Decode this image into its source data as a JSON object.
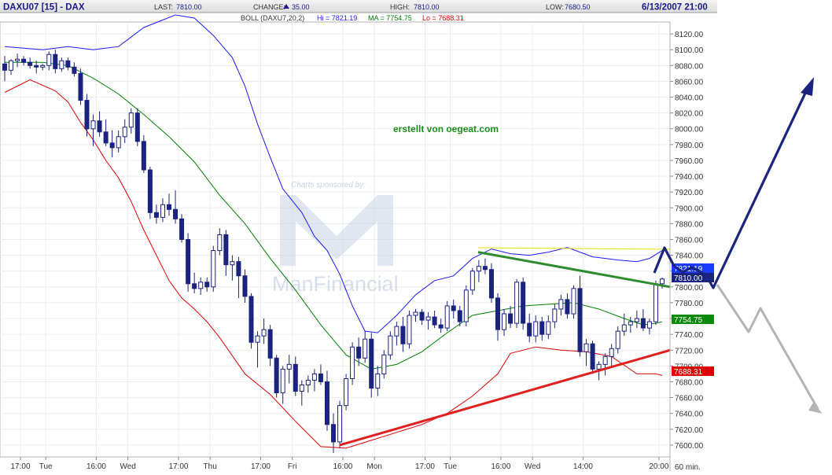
{
  "header": {
    "symbol": "DAXU07 [15] - DAX",
    "last_label": "LAST:",
    "last_value": "7810.00",
    "change_label": "CHANGE:",
    "change_value": "35.00",
    "high_label": "HIGH:",
    "high_value": "7810.00",
    "low_label": "LOW:",
    "low_value": "7680.50",
    "datetime": "6/13/2007 21:00"
  },
  "indicator": {
    "name": "BOLL (DAXU7,20,2)",
    "hi_text": "Hi = 7821.19",
    "ma_text": "MA = 7754.75",
    "lo_text": "Lo = 7688.31"
  },
  "annotation": "erstellt von oegeat.com",
  "watermark": {
    "sponsored": "Charts sponsored by:",
    "brand": "ManFinancial"
  },
  "badges": {
    "hi": "7821.19",
    "last": "7810.00",
    "ma": "7754.75",
    "lo": "7688.31"
  },
  "period": "60 min.",
  "colors": {
    "up_candle": "#ffffff",
    "down_candle": "#1a237e",
    "upper_band": "#1a1aff",
    "middle_band": "#008000",
    "lower_band": "#e00000",
    "resistance_line": "#2e8b2e",
    "support_line": "#e02020",
    "arrow_up": "#1a237e",
    "arrow_down": "#b0b0b0",
    "yellow_line": "#e8e000"
  },
  "chart_data": {
    "type": "candlestick",
    "y_ticks": [
      "7600.00",
      "7620.00",
      "7640.00",
      "7660.00",
      "7680.00",
      "7700.00",
      "7720.00",
      "7740.00",
      "7760.00",
      "7780.00",
      "7800.00",
      "7820.00",
      "7840.00",
      "7860.00",
      "7880.00",
      "7900.00",
      "7920.00",
      "7940.00",
      "7960.00",
      "7980.00",
      "8000.00",
      "8020.00",
      "8040.00",
      "8060.00",
      "8080.00",
      "8100.00",
      "8120.00"
    ],
    "x_labels": [
      "17:00",
      "Tue",
      "16:00",
      "Wed",
      "17:00",
      "Thu",
      "17:00",
      "Fri",
      "16:00",
      "Mon",
      "17:00",
      "Tue",
      "16:00",
      "Wed",
      "14:00",
      "20:00"
    ],
    "ylim": [
      7585,
      8135
    ],
    "candles": [
      [
        8082,
        8092,
        8060,
        8074
      ],
      [
        8074,
        8088,
        8068,
        8086
      ],
      [
        8086,
        8095,
        8078,
        8088
      ],
      [
        8088,
        8092,
        8080,
        8084
      ],
      [
        8084,
        8090,
        8076,
        8080
      ],
      [
        8080,
        8086,
        8070,
        8078
      ],
      [
        8078,
        8082,
        8074,
        8080
      ],
      [
        8080,
        8098,
        8074,
        8094
      ],
      [
        8094,
        8100,
        8070,
        8076
      ],
      [
        8076,
        8090,
        8072,
        8086
      ],
      [
        8086,
        8090,
        8074,
        8078
      ],
      [
        8078,
        8084,
        8066,
        8070
      ],
      [
        8070,
        8076,
        8030,
        8036
      ],
      [
        8036,
        8044,
        7990,
        8000
      ],
      [
        8000,
        8018,
        7978,
        8010
      ],
      [
        8010,
        8022,
        7990,
        7996
      ],
      [
        7996,
        8012,
        7978,
        7982
      ],
      [
        7982,
        7998,
        7964,
        7976
      ],
      [
        7976,
        7998,
        7970,
        7990
      ],
      [
        7990,
        8012,
        7982,
        8002
      ],
      [
        8002,
        8026,
        7994,
        8020
      ],
      [
        8020,
        8026,
        7978,
        7984
      ],
      [
        7984,
        7992,
        7944,
        7948
      ],
      [
        7948,
        7952,
        7886,
        7894
      ],
      [
        7894,
        7904,
        7880,
        7888
      ],
      [
        7888,
        7912,
        7882,
        7904
      ],
      [
        7904,
        7918,
        7890,
        7898
      ],
      [
        7898,
        7922,
        7880,
        7886
      ],
      [
        7886,
        7892,
        7856,
        7860
      ],
      [
        7860,
        7868,
        7794,
        7804
      ],
      [
        7804,
        7818,
        7792,
        7798
      ],
      [
        7798,
        7812,
        7790,
        7806
      ],
      [
        7806,
        7812,
        7794,
        7800
      ],
      [
        7800,
        7852,
        7794,
        7846
      ],
      [
        7846,
        7874,
        7840,
        7866
      ],
      [
        7866,
        7872,
        7814,
        7828
      ],
      [
        7828,
        7840,
        7808,
        7832
      ],
      [
        7832,
        7838,
        7786,
        7814
      ],
      [
        7814,
        7822,
        7780,
        7788
      ],
      [
        7788,
        7792,
        7722,
        7730
      ],
      [
        7730,
        7744,
        7698,
        7738
      ],
      [
        7738,
        7760,
        7728,
        7746
      ],
      [
        7746,
        7752,
        7700,
        7710
      ],
      [
        7710,
        7714,
        7660,
        7666
      ],
      [
        7666,
        7700,
        7652,
        7696
      ],
      [
        7696,
        7714,
        7678,
        7702
      ],
      [
        7702,
        7712,
        7662,
        7668
      ],
      [
        7668,
        7682,
        7650,
        7676
      ],
      [
        7676,
        7688,
        7666,
        7682
      ],
      [
        7682,
        7696,
        7668,
        7690
      ],
      [
        7690,
        7702,
        7676,
        7680
      ],
      [
        7680,
        7694,
        7618,
        7626
      ],
      [
        7626,
        7640,
        7590,
        7604
      ],
      [
        7604,
        7656,
        7596,
        7650
      ],
      [
        7650,
        7690,
        7644,
        7684
      ],
      [
        7684,
        7730,
        7676,
        7724
      ],
      [
        7724,
        7736,
        7700,
        7710
      ],
      [
        7710,
        7744,
        7704,
        7734
      ],
      [
        7734,
        7742,
        7660,
        7672
      ],
      [
        7672,
        7700,
        7662,
        7690
      ],
      [
        7690,
        7720,
        7684,
        7714
      ],
      [
        7714,
        7744,
        7708,
        7738
      ],
      [
        7738,
        7756,
        7726,
        7750
      ],
      [
        7750,
        7762,
        7718,
        7728
      ],
      [
        7728,
        7770,
        7722,
        7764
      ],
      [
        7764,
        7772,
        7756,
        7768
      ],
      [
        7768,
        7772,
        7752,
        7758
      ],
      [
        7758,
        7768,
        7746,
        7762
      ],
      [
        7762,
        7770,
        7748,
        7752
      ],
      [
        7752,
        7760,
        7742,
        7748
      ],
      [
        7748,
        7782,
        7744,
        7776
      ],
      [
        7776,
        7784,
        7760,
        7770
      ],
      [
        7770,
        7776,
        7750,
        7756
      ],
      [
        7756,
        7802,
        7750,
        7796
      ],
      [
        7796,
        7824,
        7790,
        7820
      ],
      [
        7820,
        7834,
        7806,
        7826
      ],
      [
        7826,
        7836,
        7816,
        7822
      ],
      [
        7822,
        7830,
        7780,
        7786
      ],
      [
        7786,
        7792,
        7732,
        7746
      ],
      [
        7746,
        7772,
        7738,
        7766
      ],
      [
        7766,
        7776,
        7748,
        7754
      ],
      [
        7754,
        7810,
        7748,
        7806
      ],
      [
        7806,
        7812,
        7746,
        7754
      ],
      [
        7754,
        7766,
        7730,
        7738
      ],
      [
        7738,
        7764,
        7730,
        7756
      ],
      [
        7756,
        7762,
        7732,
        7740
      ],
      [
        7740,
        7764,
        7734,
        7756
      ],
      [
        7756,
        7778,
        7748,
        7772
      ],
      [
        7772,
        7790,
        7764,
        7784
      ],
      [
        7784,
        7792,
        7760,
        7766
      ],
      [
        7766,
        7802,
        7760,
        7798
      ],
      [
        7798,
        7814,
        7712,
        7718
      ],
      [
        7718,
        7734,
        7700,
        7728
      ],
      [
        7728,
        7732,
        7690,
        7696
      ],
      [
        7696,
        7706,
        7682,
        7702
      ],
      [
        7702,
        7716,
        7688,
        7712
      ],
      [
        7712,
        7728,
        7700,
        7722
      ],
      [
        7722,
        7750,
        7716,
        7744
      ],
      [
        7744,
        7766,
        7738,
        7752
      ],
      [
        7752,
        7762,
        7742,
        7756
      ],
      [
        7756,
        7770,
        7748,
        7760
      ],
      [
        7760,
        7772,
        7744,
        7748
      ],
      [
        7748,
        7760,
        7740,
        7756
      ],
      [
        7756,
        7808,
        7752,
        7804
      ],
      [
        7804,
        7812,
        7798,
        7810
      ]
    ],
    "bollinger_upper": [
      [
        0,
        8104
      ],
      [
        6,
        8100
      ],
      [
        10,
        8104
      ],
      [
        14,
        8100
      ],
      [
        18,
        8104
      ],
      [
        22,
        8128
      ],
      [
        27,
        8144
      ],
      [
        30,
        8140
      ],
      [
        33,
        8118
      ],
      [
        36,
        8090
      ],
      [
        38,
        8054
      ],
      [
        40,
        8006
      ],
      [
        42,
        7964
      ],
      [
        44,
        7924
      ],
      [
        47,
        7894
      ],
      [
        49,
        7864
      ],
      [
        51,
        7846
      ],
      [
        53,
        7816
      ],
      [
        55,
        7776
      ],
      [
        57,
        7744
      ],
      [
        59,
        7742
      ],
      [
        62,
        7764
      ],
      [
        65,
        7790
      ],
      [
        68,
        7808
      ],
      [
        71,
        7814
      ],
      [
        74,
        7836
      ],
      [
        77,
        7848
      ],
      [
        80,
        7842
      ],
      [
        83,
        7840
      ],
      [
        86,
        7844
      ],
      [
        89,
        7850
      ],
      [
        93,
        7838
      ],
      [
        97,
        7834
      ],
      [
        100,
        7832
      ],
      [
        102,
        7836
      ],
      [
        104,
        7846
      ]
    ],
    "bollinger_middle": [
      [
        0,
        8084
      ],
      [
        6,
        8084
      ],
      [
        10,
        8080
      ],
      [
        14,
        8064
      ],
      [
        18,
        8044
      ],
      [
        22,
        8018
      ],
      [
        26,
        7990
      ],
      [
        30,
        7958
      ],
      [
        34,
        7916
      ],
      [
        38,
        7880
      ],
      [
        42,
        7836
      ],
      [
        46,
        7796
      ],
      [
        50,
        7752
      ],
      [
        54,
        7714
      ],
      [
        58,
        7696
      ],
      [
        62,
        7702
      ],
      [
        66,
        7718
      ],
      [
        70,
        7742
      ],
      [
        74,
        7764
      ],
      [
        78,
        7770
      ],
      [
        82,
        7776
      ],
      [
        86,
        7778
      ],
      [
        90,
        7780
      ],
      [
        94,
        7772
      ],
      [
        98,
        7760
      ],
      [
        101,
        7752
      ],
      [
        103,
        7754
      ],
      [
        104,
        7756
      ]
    ],
    "bollinger_lower": [
      [
        0,
        8046
      ],
      [
        4,
        8062
      ],
      [
        8,
        8048
      ],
      [
        10,
        8034
      ],
      [
        12,
        8008
      ],
      [
        14,
        7986
      ],
      [
        16,
        7960
      ],
      [
        18,
        7938
      ],
      [
        20,
        7908
      ],
      [
        22,
        7872
      ],
      [
        24,
        7840
      ],
      [
        26,
        7808
      ],
      [
        28,
        7786
      ],
      [
        30,
        7772
      ],
      [
        32,
        7756
      ],
      [
        34,
        7736
      ],
      [
        38,
        7690
      ],
      [
        42,
        7664
      ],
      [
        46,
        7630
      ],
      [
        50,
        7598
      ],
      [
        54,
        7596
      ],
      [
        58,
        7606
      ],
      [
        62,
        7616
      ],
      [
        66,
        7626
      ],
      [
        70,
        7640
      ],
      [
        74,
        7662
      ],
      [
        78,
        7690
      ],
      [
        80,
        7716
      ],
      [
        84,
        7724
      ],
      [
        88,
        7720
      ],
      [
        92,
        7718
      ],
      [
        96,
        7712
      ],
      [
        100,
        7690
      ],
      [
        103,
        7690
      ],
      [
        104,
        7688
      ]
    ],
    "resistance_line": [
      [
        7810.0,
        7844
      ],
      [
        7818.0,
        7800
      ]
    ],
    "support_line": [
      [
        7590,
        7600
      ],
      [
        7716,
        7720
      ]
    ]
  }
}
